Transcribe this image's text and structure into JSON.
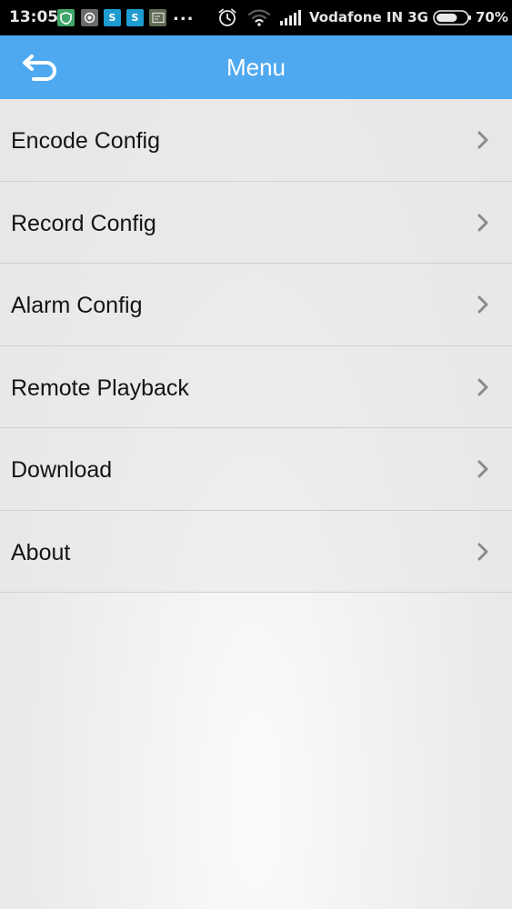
{
  "status_bar": {
    "time": "13:05",
    "notification_icons": [
      {
        "name": "shield-notification-icon",
        "glyph": "",
        "bg": "#3fa56a"
      },
      {
        "name": "radar-notification-icon",
        "glyph": "",
        "bg": "#6b6b6b"
      },
      {
        "name": "skype-notification-icon",
        "glyph": "S",
        "bg": "#1e9bd0"
      },
      {
        "name": "skype-notification-icon",
        "glyph": "S",
        "bg": "#1e9bd0"
      },
      {
        "name": "terminal-notification-icon",
        "glyph": "",
        "bg": "#5f6b52"
      }
    ],
    "more_indicator": "...",
    "carrier": "Vodafone IN 3G",
    "battery_percent": "70%",
    "battery_level": 0.7
  },
  "title_bar": {
    "title": "Menu",
    "back_icon": "back-arrow-icon",
    "color": "#4fa9f0"
  },
  "menu": {
    "items": [
      {
        "label": "Encode Config"
      },
      {
        "label": "Record Config"
      },
      {
        "label": "Alarm Config"
      },
      {
        "label": "Remote Playback"
      },
      {
        "label": "Download"
      },
      {
        "label": "About"
      }
    ]
  }
}
